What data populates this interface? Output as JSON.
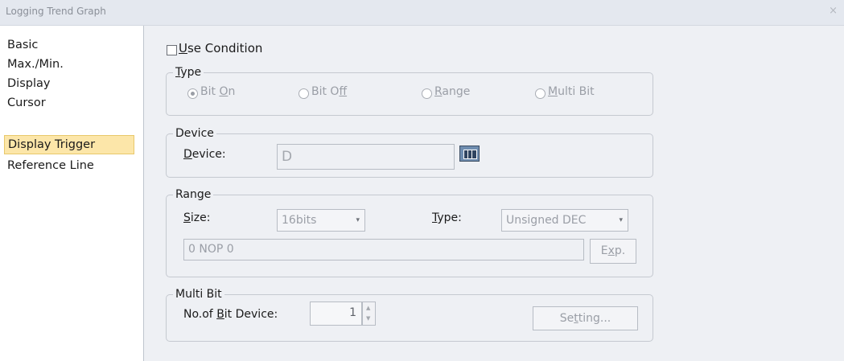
{
  "window": {
    "title": "Logging Trend Graph",
    "close_glyph": "×"
  },
  "sidebar": {
    "items": [
      {
        "label": "Basic"
      },
      {
        "label": "Max./Min."
      },
      {
        "label": "Display"
      },
      {
        "label": "Cursor"
      },
      {
        "label": "Display Trigger",
        "selected": true
      },
      {
        "label": "Reference Line"
      }
    ]
  },
  "use_condition": {
    "mnemonic": "U",
    "rest": "se Condition",
    "checked": false
  },
  "type_group": {
    "legend_mnemonic": "T",
    "legend_rest": "ype",
    "options": [
      {
        "before": "Bit ",
        "mnemonic": "O",
        "after": "n",
        "selected": true
      },
      {
        "before": "Bit O",
        "mnemonic": "f",
        "after": "f",
        "selected": false
      },
      {
        "before": "",
        "mnemonic": "R",
        "after": "ange",
        "selected": false
      },
      {
        "before": "",
        "mnemonic": "M",
        "after": "ulti Bit",
        "selected": false
      }
    ]
  },
  "device_group": {
    "legend": "Device",
    "label_mnemonic": "D",
    "label_rest": "evice:",
    "value": "D"
  },
  "range_group": {
    "legend": "Range",
    "size_mnemonic": "S",
    "size_rest": "ize:",
    "size_value": "16bits",
    "type_mnemonic": "T",
    "type_rest": "ype:",
    "type_value": "Unsigned DEC",
    "expression": "0 NOP 0",
    "exp_before": "E",
    "exp_mnemonic": "x",
    "exp_after": "p."
  },
  "multibit_group": {
    "legend": "Multi Bit",
    "label_before": "No.of ",
    "label_mnemonic": "B",
    "label_after": "it Device:",
    "value": "1",
    "setting_before": "Se",
    "setting_mnemonic": "t",
    "setting_after": "ting..."
  },
  "icons": {
    "dropdown": "▾",
    "spin_up": "▲",
    "spin_down": "▼"
  }
}
